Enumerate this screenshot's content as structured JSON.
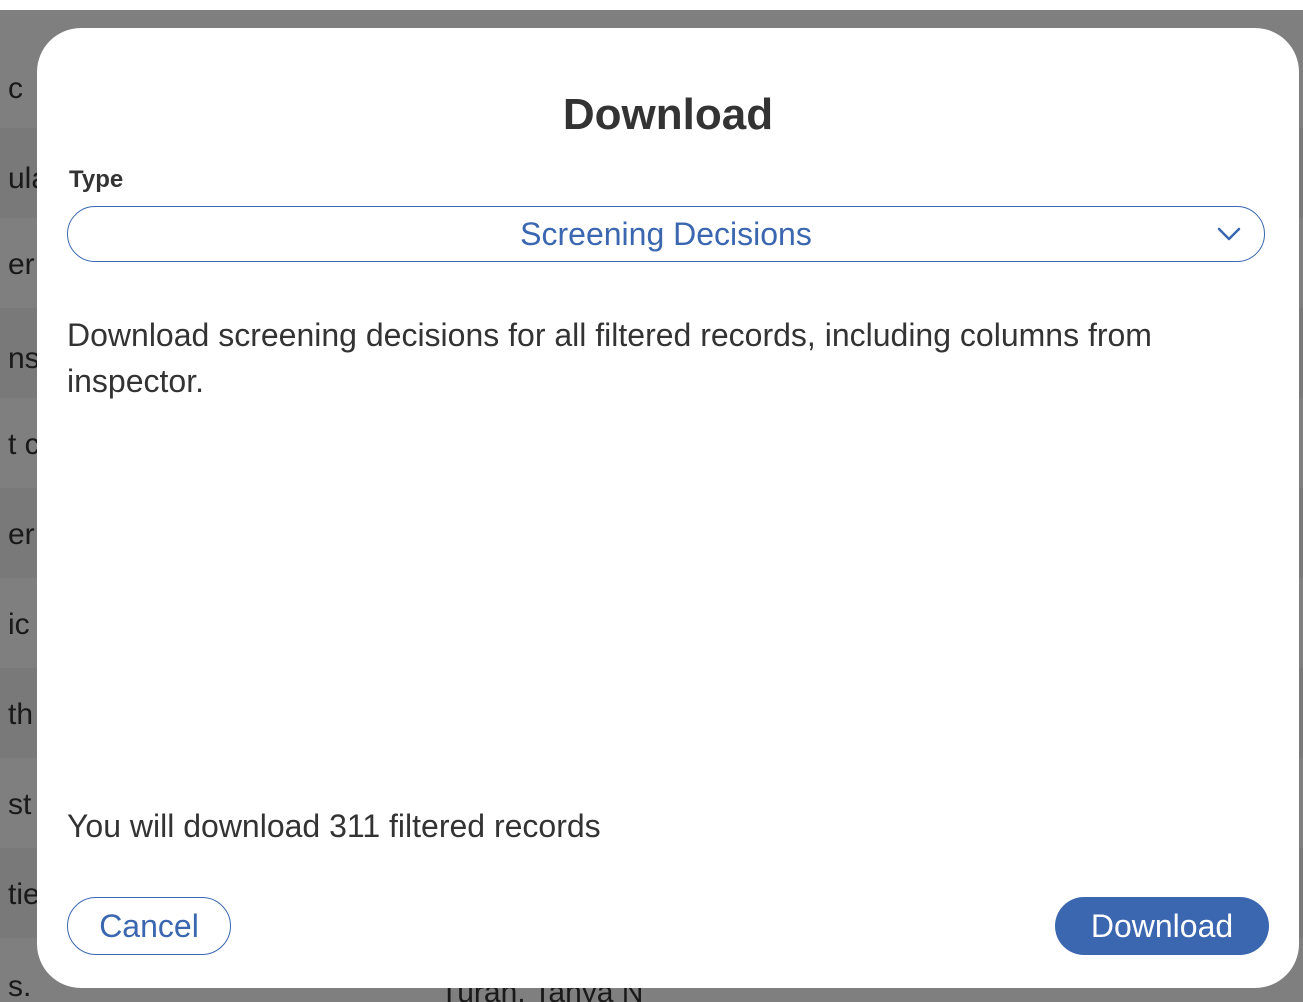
{
  "background": {
    "row_fragments": [
      "c",
      "ula",
      "er",
      "ns",
      "t c",
      "er",
      "ic",
      "th",
      "st",
      "tie",
      "s."
    ],
    "footer_text": "Turan, Tanya N"
  },
  "modal": {
    "title": "Download",
    "type_label": "Type",
    "type_select": {
      "selected": "Screening Decisions"
    },
    "description": "Download screening decisions for all filtered records, including columns from inspector.",
    "record_count_text": "You will download 311 filtered records",
    "cancel_label": "Cancel",
    "download_label": "Download"
  },
  "colors": {
    "accent": "#3b67b0",
    "text": "#333333",
    "overlay": "rgba(0,0,0,0.5)"
  },
  "icons": {
    "select_chevron": "chevron-down-icon"
  }
}
